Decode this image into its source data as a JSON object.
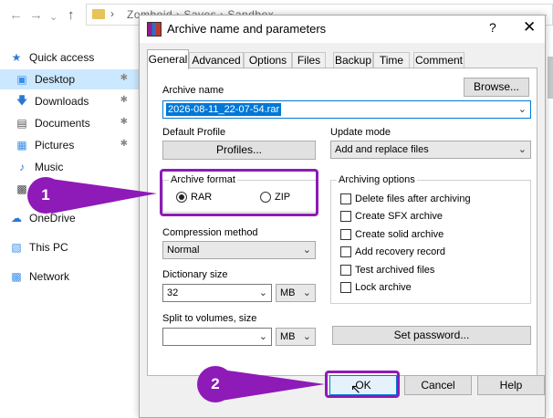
{
  "explorer": {
    "path_visible": "Zomboid › Saves › Sandbox",
    "sidebar": [
      {
        "label": "Quick access",
        "icon": "star-icon"
      },
      {
        "label": "Desktop",
        "icon": "desktop-icon",
        "selected": true
      },
      {
        "label": "Downloads",
        "icon": "download-icon"
      },
      {
        "label": "Documents",
        "icon": "documents-icon"
      },
      {
        "label": "Pictures",
        "icon": "pictures-icon"
      },
      {
        "label": "Music",
        "icon": "music-icon"
      },
      {
        "label": "OneDrive",
        "icon": "cloud-icon"
      },
      {
        "label": "This PC",
        "icon": "computer-icon"
      },
      {
        "label": "Network",
        "icon": "network-icon"
      }
    ]
  },
  "dialog": {
    "title": "Archive name and parameters",
    "help_label": "?",
    "close_label": "✕",
    "tabs": [
      "General",
      "Advanced",
      "Options",
      "Files",
      "Backup",
      "Time",
      "Comment"
    ],
    "active_tab": "General",
    "archive_name_label": "Archive name",
    "browse_label": "Browse...",
    "archive_name_value": "2026-08-11_22-07-54.rar",
    "default_profile_label": "Default Profile",
    "profiles_label": "Profiles...",
    "update_mode_label": "Update mode",
    "update_mode_value": "Add and replace files",
    "archive_format_label": "Archive format",
    "format_rar": "RAR",
    "format_zip": "ZIP",
    "selected_format": "RAR",
    "compression_method_label": "Compression method",
    "compression_method_value": "Normal",
    "dictionary_size_label": "Dictionary size",
    "dictionary_size_value": "32",
    "dictionary_unit": "MB",
    "split_label": "Split to volumes, size",
    "split_value": "",
    "split_unit": "MB",
    "archiving_options_label": "Archiving options",
    "options": [
      {
        "label": "Delete files after archiving",
        "checked": false
      },
      {
        "label": "Create SFX archive",
        "checked": false
      },
      {
        "label": "Create solid archive",
        "checked": false
      },
      {
        "label": "Add recovery record",
        "checked": false
      },
      {
        "label": "Test archived files",
        "checked": false
      },
      {
        "label": "Lock archive",
        "checked": false
      }
    ],
    "set_password_label": "Set password...",
    "ok_label": "OK",
    "cancel_label": "Cancel",
    "help_button_label": "Help"
  },
  "annotations": {
    "step1": "1",
    "step2": "2",
    "highlight_color": "#8e1ab8"
  }
}
